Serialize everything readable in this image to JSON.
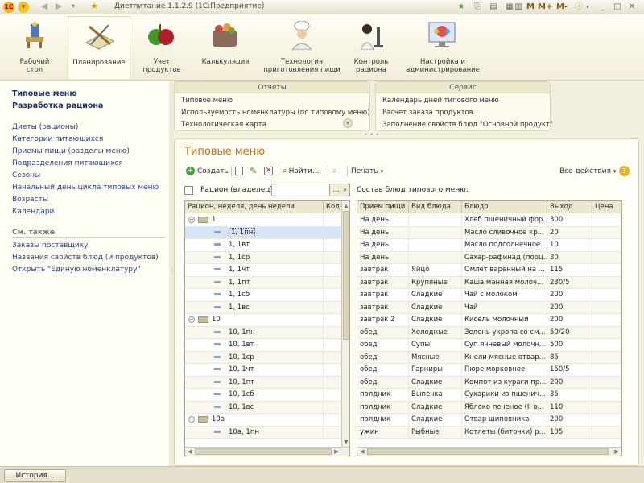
{
  "window": {
    "title": "Диетпитание 1.1.2.9  (1С:Предприятие)",
    "right_icons": [
      "М",
      "М+",
      "М-"
    ]
  },
  "sections": [
    {
      "label": "Рабочий\nстол",
      "icon": "desktop-icon"
    },
    {
      "label": "Планирование",
      "icon": "planning-icon"
    },
    {
      "label": "Учет\nпродуктов",
      "icon": "apples-icon"
    },
    {
      "label": "Калькуляция",
      "icon": "basket-icon"
    },
    {
      "label": "Технология\nприготовления пищи",
      "icon": "chef-icon"
    },
    {
      "label": "Контроль\nрациона",
      "icon": "microscope-icon"
    },
    {
      "label": "Настройка и\nадминистрирование",
      "icon": "settings-monitor-icon"
    }
  ],
  "leftnav": {
    "bold_items": [
      "Типовые меню",
      "Разработка рациона"
    ],
    "items": [
      "Диеты (рационы)",
      "Категории питающихся",
      "Приемы пищи (разделы меню)",
      "Подразделения питающихся",
      "Сезоны",
      "Начальный день цикла типовых меню",
      "Возрасты",
      "Календари"
    ],
    "see_also_header": "См. также",
    "see_also": [
      "Заказы поставщику",
      "Названия свойств блюд (и продуктов)",
      "Открыть \"Единую номенклатуру\""
    ]
  },
  "reports_panel": {
    "header": "Отчеты",
    "items": [
      "Типовое меню",
      "Используемость номенклатуры (по типовому меню)",
      "Технологическая карта"
    ]
  },
  "service_panel": {
    "header": "Сервис",
    "items": [
      "Календарь дней типового меню",
      "Расчет заказа продуктов",
      "Заполнение свойств блюд \"Основной продукт\""
    ]
  },
  "form": {
    "title": "Типовые меню",
    "toolbar": {
      "create": "Создать",
      "find": "Найти...",
      "print": "Печать",
      "all_actions": "Все действия",
      "help": "?"
    },
    "filter_label": "Рацион (владелец):",
    "filter_value": "",
    "filter_button": "...",
    "composition_label": "Состав блюд типового меню:"
  },
  "left_table": {
    "columns": [
      "Рацион, неделя, день недели",
      "Код"
    ],
    "rows": [
      {
        "kind": "group",
        "text": "1",
        "toggle": "⊖"
      },
      {
        "kind": "item",
        "text": "1, 1пн",
        "selected": true
      },
      {
        "kind": "item",
        "text": "1, 1вт"
      },
      {
        "kind": "item",
        "text": "1, 1ср"
      },
      {
        "kind": "item",
        "text": "1, 1чт"
      },
      {
        "kind": "item",
        "text": "1, 1пт"
      },
      {
        "kind": "item",
        "text": "1, 1сб"
      },
      {
        "kind": "item",
        "text": "1, 1вс"
      },
      {
        "kind": "group",
        "text": "10",
        "toggle": "⊖"
      },
      {
        "kind": "item",
        "text": "10, 1пн"
      },
      {
        "kind": "item",
        "text": "10, 1вт"
      },
      {
        "kind": "item",
        "text": "10, 1ср"
      },
      {
        "kind": "item",
        "text": "10, 1чт"
      },
      {
        "kind": "item",
        "text": "10, 1пт"
      },
      {
        "kind": "item",
        "text": "10, 1сб"
      },
      {
        "kind": "item",
        "text": "10, 1вс"
      },
      {
        "kind": "group",
        "text": "10а",
        "toggle": "⊖"
      },
      {
        "kind": "item",
        "text": "10а, 1пн"
      }
    ]
  },
  "right_table": {
    "columns": [
      "Прием пищи",
      "Вид блюда",
      "Блюдо",
      "Выход",
      "Цена"
    ],
    "rows": [
      [
        "На день",
        "",
        "Хлеб пшеничный фор...",
        "300",
        ""
      ],
      [
        "На день",
        "",
        "Масло сливочное кр...",
        "20",
        ""
      ],
      [
        "На день",
        "",
        "Масло подсолнечное...",
        "10",
        ""
      ],
      [
        "На день",
        "",
        "Сахар-рафинад (порц...",
        "30",
        ""
      ],
      [
        "завтрак",
        "Яйцо",
        "Омлет варенный на ...",
        "115",
        ""
      ],
      [
        "завтрак",
        "Крупяные",
        "Каша манная молоч...",
        "230/5",
        ""
      ],
      [
        "завтрак",
        "Сладкие",
        "Чай с молоком",
        "200",
        ""
      ],
      [
        "завтрак",
        "Сладкие",
        "Чай",
        "200",
        ""
      ],
      [
        "завтрак 2",
        "Сладкие",
        "Кисель молочный",
        "200",
        ""
      ],
      [
        "обед",
        "Холодные",
        "Зелень укропа со см...",
        "50/20",
        ""
      ],
      [
        "обед",
        "Супы",
        "Суп ячневый молочн...",
        "500",
        ""
      ],
      [
        "обед",
        "Мясные",
        "Кнели мясные отвар...",
        "85",
        ""
      ],
      [
        "обед",
        "Гарниры",
        "Пюре морковное",
        "150/5",
        ""
      ],
      [
        "обед",
        "Сладкие",
        "Компот из кураги пр...",
        "200",
        ""
      ],
      [
        "полдник",
        "Выпечка",
        "Сухарики из пшенич...",
        "35",
        ""
      ],
      [
        "полдник",
        "Сладкие",
        "Яблоко печеное (II в...",
        "110",
        ""
      ],
      [
        "полдник",
        "Сладкие",
        "Отвар шиповника",
        "200",
        ""
      ],
      [
        "ужин",
        "Рыбные",
        "Котлеты (биточки) р...",
        "105",
        ""
      ]
    ]
  },
  "bottom": {
    "history_label": "История..."
  }
}
